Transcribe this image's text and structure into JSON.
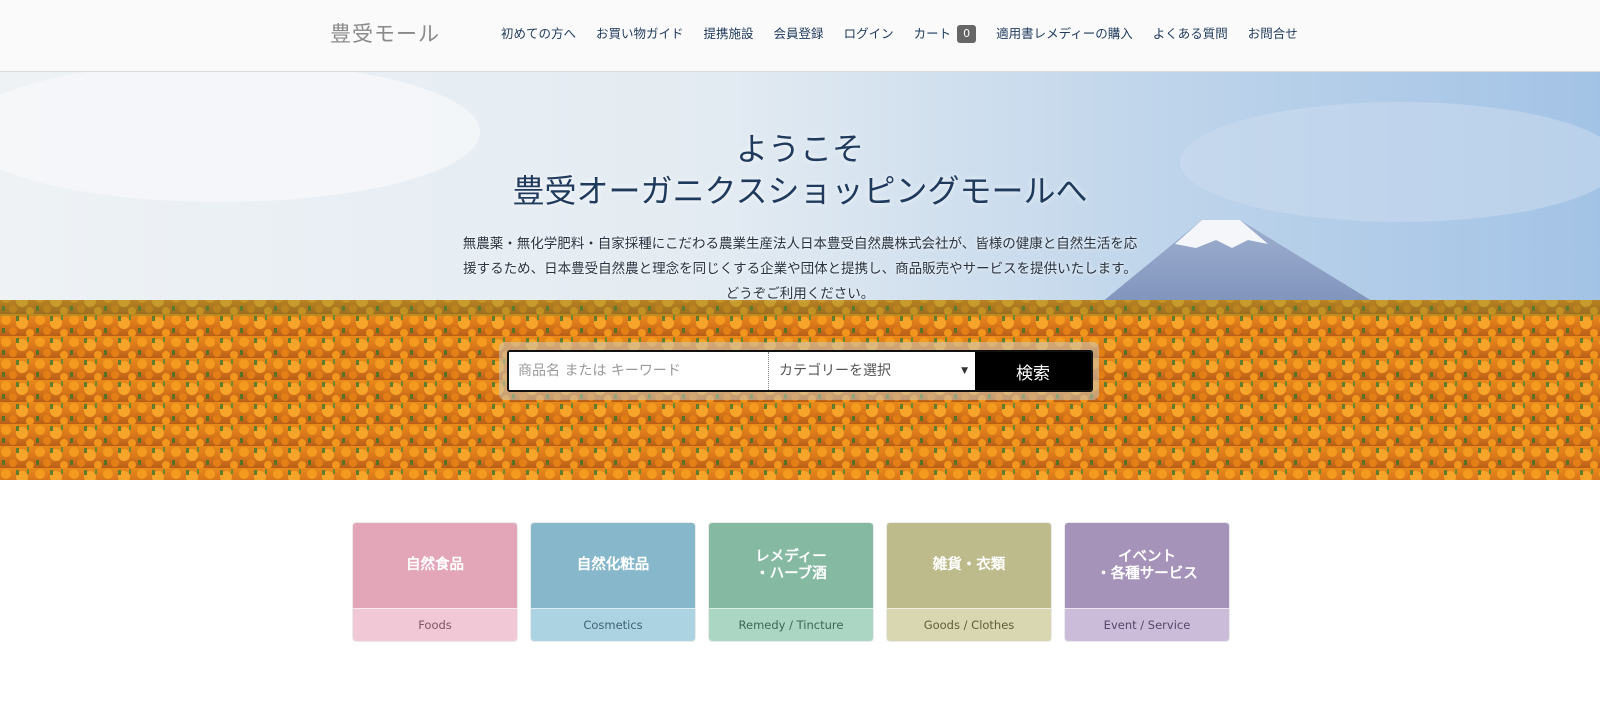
{
  "header": {
    "logo": "豊受モール",
    "nav": [
      {
        "id": "first-time",
        "label": "初めての方へ"
      },
      {
        "id": "shopping-guide",
        "label": "お買い物ガイド"
      },
      {
        "id": "partners",
        "label": "提携施設"
      },
      {
        "id": "register",
        "label": "会員登録"
      },
      {
        "id": "login",
        "label": "ログイン"
      },
      {
        "id": "cart",
        "label": "カート",
        "count": "0"
      },
      {
        "id": "remedy-purchase",
        "label": "適用書レメディーの購入"
      },
      {
        "id": "faq",
        "label": "よくある質問"
      },
      {
        "id": "contact",
        "label": "お問合せ"
      }
    ]
  },
  "hero": {
    "title_line1": "ようこそ",
    "title_line2": "豊受オーガニクスショッピングモールへ",
    "description": "無農薬・無化学肥料・自家採種にこだわる農業生産法人日本豊受自然農株式会社が、皆様の健康と自然生活を応援するため、日本豊受自然農と理念を同じくする企業や団体と提携し、商品販売やサービスを提供いたします。どうぞご利用ください。",
    "search": {
      "placeholder": "商品名 または キーワード",
      "category_placeholder": "カテゴリーを選択",
      "button": "検索"
    }
  },
  "categories": [
    {
      "id": "foods",
      "label": "自然食品",
      "sub": "Foods",
      "top_color": "#e3a6b9",
      "bottom_color": "#f1c9d6",
      "sub_color": "#7d5563"
    },
    {
      "id": "cosmetics",
      "label": "自然化粧品",
      "sub": "Cosmetics",
      "top_color": "#86b7ca",
      "bottom_color": "#acd3e2",
      "sub_color": "#3f6270"
    },
    {
      "id": "remedy",
      "label": "レメディー\n・ハーブ酒",
      "sub": "Remedy / Tincture",
      "top_color": "#85b9a2",
      "bottom_color": "#acd6c4",
      "sub_color": "#3e6655"
    },
    {
      "id": "goods",
      "label": "雑貨・衣類",
      "sub": "Goods / Clothes",
      "top_color": "#bdbb8b",
      "bottom_color": "#d8d7b1",
      "sub_color": "#5f5d3a"
    },
    {
      "id": "event",
      "label": "イベント\n・各種サービス",
      "sub": "Event / Service",
      "top_color": "#a693b9",
      "bottom_color": "#cbbdd9",
      "sub_color": "#55466a"
    }
  ]
}
